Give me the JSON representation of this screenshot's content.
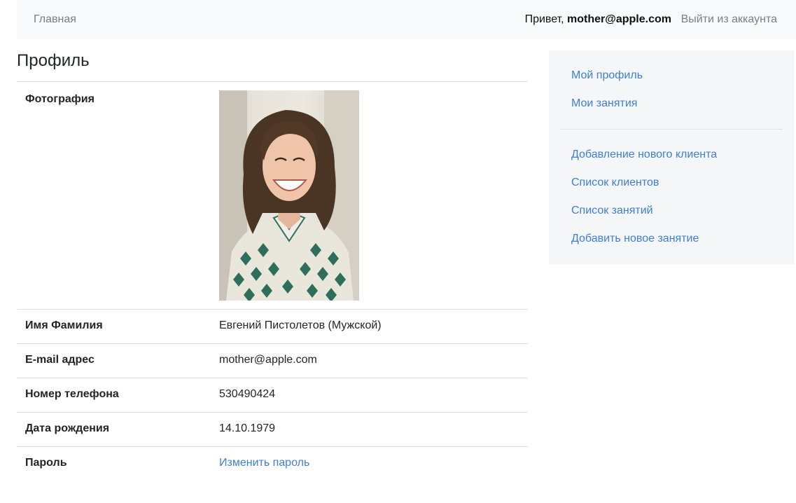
{
  "navbar": {
    "home_label": "Главная",
    "greeting_prefix": "Привет, ",
    "user_email": "mother@apple.com",
    "logout_label": "Выйти из аккаунта"
  },
  "page_title": "Профиль",
  "profile": {
    "photo_label": "Фотография",
    "name_label": "Имя Фамилия",
    "name_value": "Евгений Пистолетов (Мужской)",
    "email_label": "E-mail адрес",
    "email_value": "mother@apple.com",
    "phone_label": "Номер телефона",
    "phone_value": "530490424",
    "birth_label": "Дата рождения",
    "birth_value": "14.10.1979",
    "password_label": "Пароль",
    "password_link": "Изменить пароль"
  },
  "sidebar": {
    "my_profile": "Мой профиль",
    "my_lessons": "Мои занятия",
    "add_client": "Добавление нового клиента",
    "client_list": "Список клиентов",
    "lesson_list": "Список занятий",
    "add_lesson": "Добавить новое занятие"
  },
  "colors": {
    "link": "#3f7fd1",
    "navbar_bg": "#f8f9fa",
    "sidebar_bg": "#f5f6f8",
    "divider": "#dee2e6"
  }
}
